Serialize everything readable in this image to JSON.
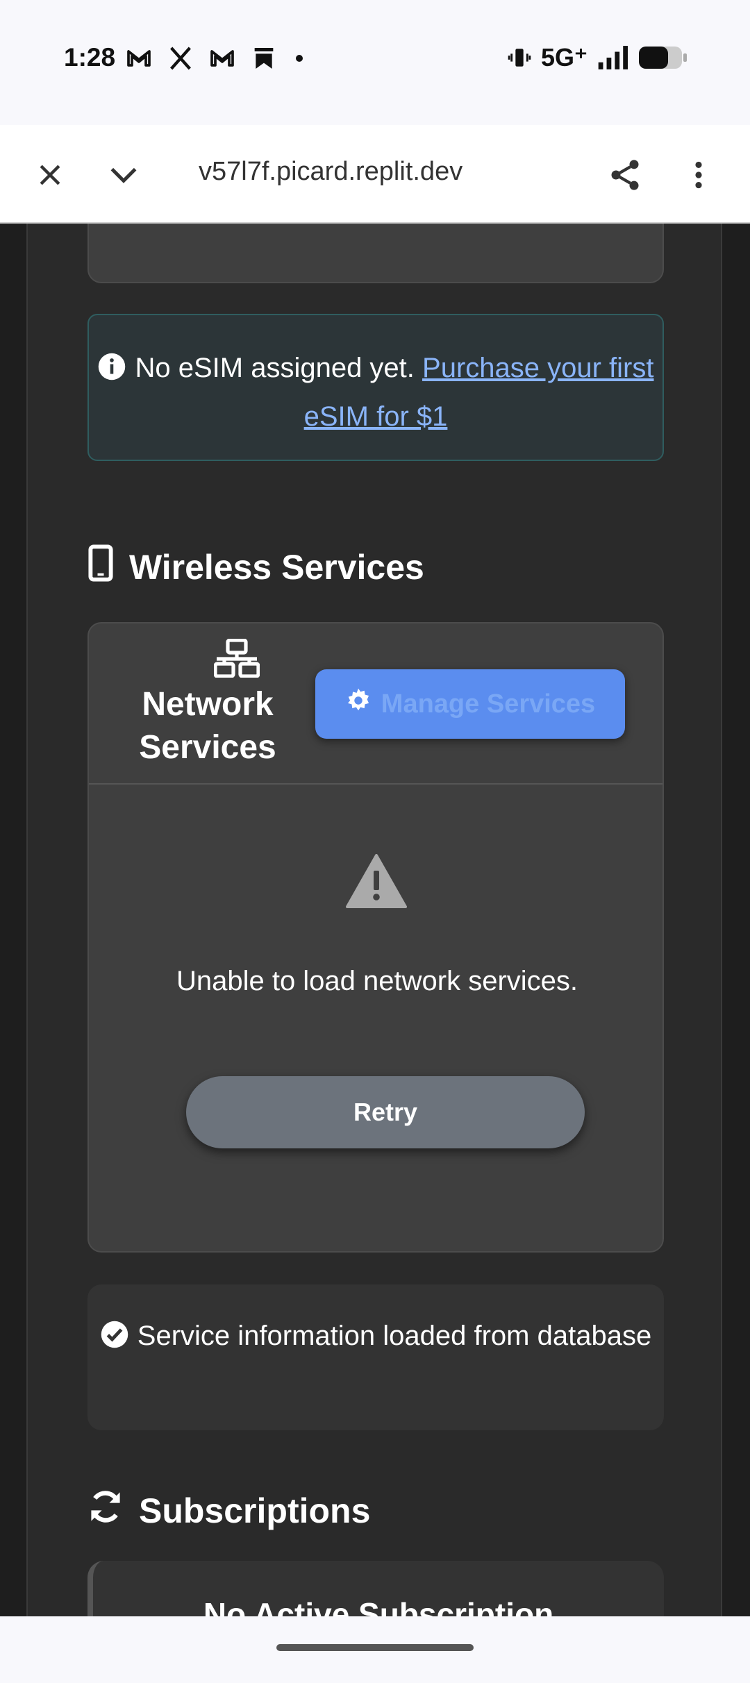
{
  "status_bar": {
    "time": "1:28",
    "app_icons": [
      "gmail-icon",
      "x-icon",
      "gmail-icon",
      "bookmark-icon"
    ],
    "network": "5G⁺",
    "battery_level_percent": 65
  },
  "browser": {
    "url": "v57l7f.picard.replit.dev",
    "icons": [
      "close-icon",
      "chevron-down-icon",
      "share-icon",
      "more-vert-icon"
    ]
  },
  "alert": {
    "text": "No eSIM assigned yet.",
    "link": "Purchase your first eSIM for $1",
    "color": "#2c3538"
  },
  "wireless": {
    "title": "Wireless Services",
    "network_label": "Network Services",
    "manage_button": "Manage Services",
    "error": "Unable to load network services.",
    "retry_button": "Retry"
  },
  "db_note": {
    "text": "Service information loaded from database"
  },
  "subscriptions": {
    "title": "Subscriptions",
    "card_title": "No Active Subscription"
  },
  "colors": {
    "accent": "#5b8def",
    "link": "#8ab4f8",
    "background": "#2a2a2a"
  }
}
